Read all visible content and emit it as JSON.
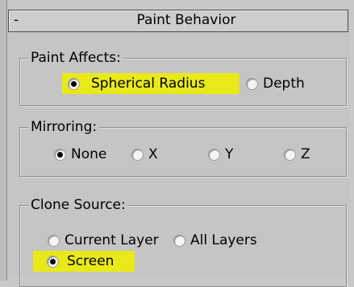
{
  "panel": {
    "collapse_symbol": "-",
    "title": "Paint Behavior"
  },
  "paint_affects": {
    "legend": "Paint Affects:",
    "options": [
      "Spherical Radius",
      "Depth"
    ],
    "selected": "Spherical Radius"
  },
  "mirroring": {
    "legend": "Mirroring:",
    "options": [
      "None",
      "X",
      "Y",
      "Z"
    ],
    "selected": "None"
  },
  "clone_source": {
    "legend": "Clone Source:",
    "options": [
      "Current Layer",
      "All Layers",
      "Screen"
    ],
    "selected": "Screen"
  },
  "highlight_color": "#e9e91a"
}
